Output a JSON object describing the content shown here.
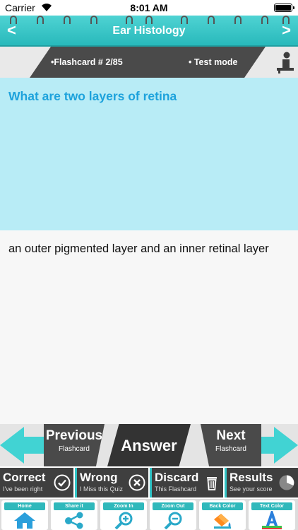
{
  "status_bar": {
    "carrier": "Carrier",
    "time": "8:01 AM"
  },
  "title_bar": {
    "title": "Ear Histology",
    "prev_symbol": "<",
    "next_symbol": ">"
  },
  "info_bar": {
    "flashcard": "•Flashcard # 2/85",
    "mode": "• Test mode"
  },
  "question": {
    "text": "What are two layers of retina"
  },
  "answer": {
    "text": "an outer pigmented layer and an inner retinal layer"
  },
  "nav": {
    "previous": {
      "label": "Previous",
      "sub": "Flashcard"
    },
    "answer_label": "Answer",
    "next": {
      "label": "Next",
      "sub": "Flashcard"
    }
  },
  "actions": [
    {
      "title": "Correct",
      "sub": "I've been right"
    },
    {
      "title": "Wrong",
      "sub": "I Miss this Quiz"
    },
    {
      "title": "Discard",
      "sub": "This Flashcard"
    },
    {
      "title": "Results",
      "sub": "See your score"
    }
  ],
  "toolbar": [
    {
      "label": "Home"
    },
    {
      "label": "Share it"
    },
    {
      "label": "Zoom In"
    },
    {
      "label": "Zoom Out"
    },
    {
      "label": "Back Color"
    },
    {
      "label": "Text Color"
    }
  ],
  "colors": {
    "accent": "#30c4c6",
    "question_bg": "#b8ecf6",
    "question_text": "#1da2dc",
    "dark": "#3f3f3f"
  }
}
